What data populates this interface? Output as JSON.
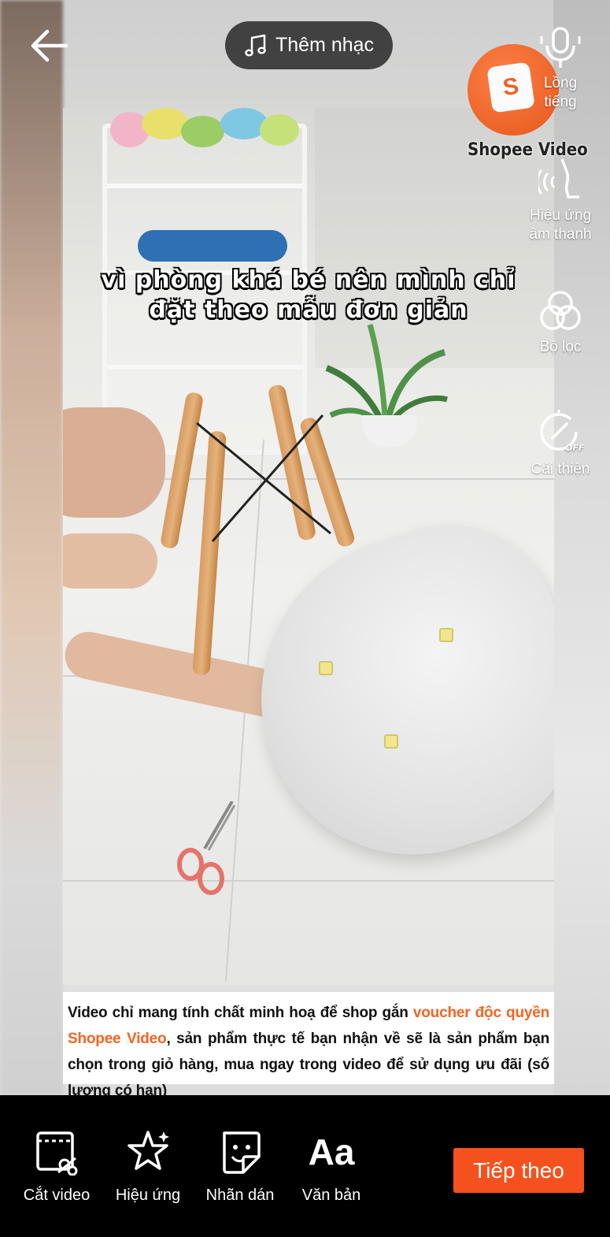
{
  "top_bar": {
    "music_label": "Thêm nhạc"
  },
  "right_tools": {
    "voiceover": "Lồng\ntiếng",
    "sound_effects": "Hiệu ứng\nâm thanh",
    "filters": "Bộ lọc",
    "enhance": "Cải thiện",
    "enhance_state": "OFF"
  },
  "watermark": {
    "label": "Shopee Video"
  },
  "video": {
    "caption_line1": "vì phòng khá bé nên mình chỉ",
    "caption_line2": "đặt theo mẫu đơn giản",
    "disclaimer_part1": "Video chỉ mang tính chất minh hoạ để shop gắn ",
    "disclaimer_highlight": "voucher độc quyền Shopee Video",
    "disclaimer_part2": ", sản phẩm thực tế bạn nhận về sẽ là sản phẩm bạn chọn trong giỏ hàng, mua ngay trong video để sử dụng ưu đãi (số lượng có hạn)"
  },
  "bottom_tools": {
    "cut_video": "Cắt video",
    "effects": "Hiệu ứng",
    "stickers": "Nhãn dán",
    "text": "Văn bản",
    "text_icon": "Aa"
  },
  "next_button": "Tiếp theo",
  "colors": {
    "accent": "#f4511e",
    "highlight_text": "#f26522"
  }
}
